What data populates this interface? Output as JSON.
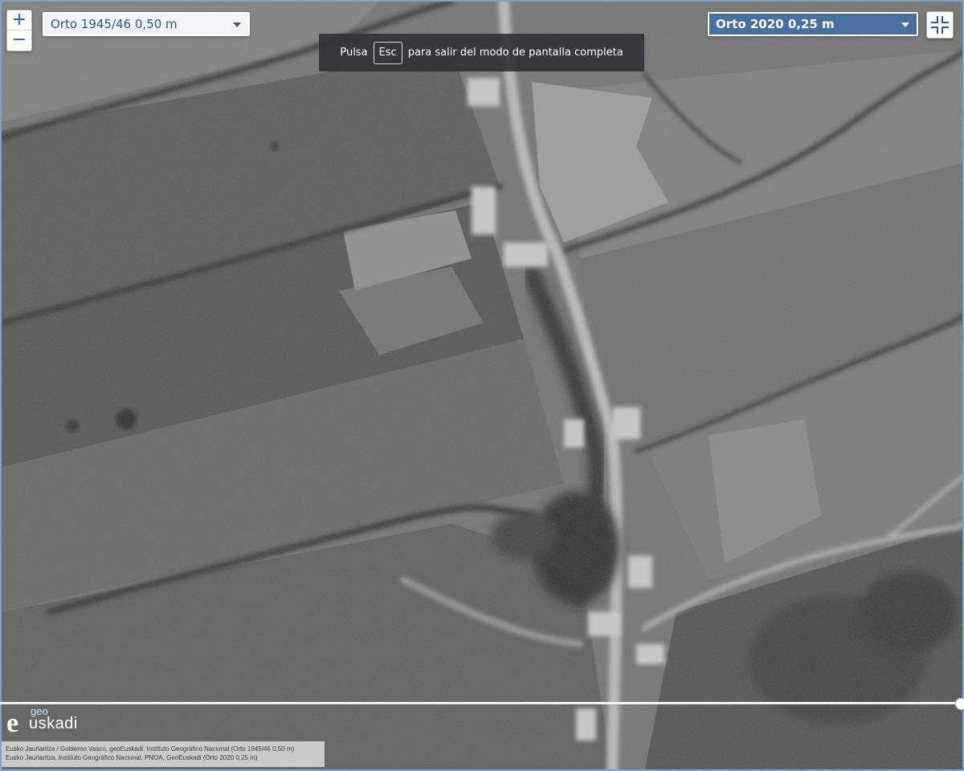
{
  "zoom": {
    "in_label": "+",
    "out_label": "−"
  },
  "layers": {
    "left_selected": "Orto 1945/46 0,50 m",
    "right_selected": "Orto 2020 0,25 m"
  },
  "fullscreen_notice": {
    "prefix": "Pulsa",
    "key": "Esc",
    "suffix": "para salir del modo de pantalla completa"
  },
  "logo": {
    "letter": "e",
    "prefix": "geo",
    "name": "uskadi"
  },
  "attribution": {
    "line1": "Eusko Jaurlaritza / Gobierno Vasco, geoEuskadi, Instituto Geográfico Nacional (Orto 1945/46 0,50 m)",
    "line2": "Eusko Jaurlaritza, Instituto Geográfico Nacional, PNOA, GeoEuskadi (Orto 2020 0,25 m)"
  },
  "colors": {
    "frame": "#7fa3c8",
    "right_select_bg": "#4a6f9f",
    "toast_bg": "#2d3237"
  },
  "icons": {
    "fullscreen_exit": "compress-icon",
    "dropdown": "chevron-down-icon",
    "swipe": "swipe-handle-icon"
  }
}
